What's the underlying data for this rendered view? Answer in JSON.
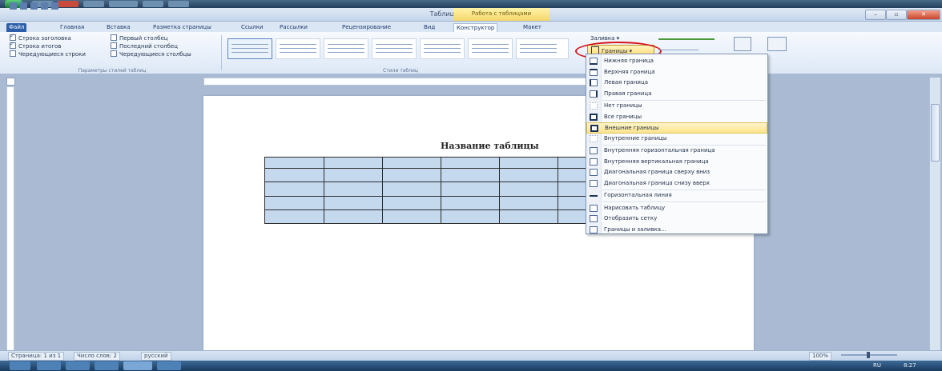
{
  "window": {
    "title": "Таблица - Microsoft Word",
    "context_group": "Работа с таблицами",
    "buttons": {
      "minimize": "–",
      "maximize": "▫",
      "close": "✕"
    }
  },
  "tabs": [
    {
      "label": "Файл",
      "kind": "file"
    },
    {
      "label": "Главная"
    },
    {
      "label": "Вставка"
    },
    {
      "label": "Разметка страницы"
    },
    {
      "label": "Ссылки"
    },
    {
      "label": "Рассылки"
    },
    {
      "label": "Рецензирование"
    },
    {
      "label": "Вид"
    },
    {
      "label": "Конструктор",
      "kind": "active"
    },
    {
      "label": "Макет"
    }
  ],
  "ribbon": {
    "style_options": {
      "col1": [
        {
          "label": "Строка заголовка",
          "checked": true
        },
        {
          "label": "Строка итогов",
          "checked": true
        },
        {
          "label": "Чередующиеся строки",
          "checked": false
        }
      ],
      "col2": [
        {
          "label": "Первый столбец",
          "checked": false
        },
        {
          "label": "Последний столбец",
          "checked": false
        },
        {
          "label": "Чередующиеся столбцы",
          "checked": false
        }
      ],
      "group_label": "Параметры стилей таблиц"
    },
    "styles_group_label": "Стили таблиц",
    "fill_label": "Заливка ▾",
    "borders_label": "Границы ▾",
    "draw_table": "Нарисовать таблицу",
    "eraser": "Ластик"
  },
  "document": {
    "heading": "Название таблицы",
    "table": {
      "rows": 4,
      "cols": 6
    }
  },
  "menu": {
    "items": [
      {
        "label": "Нижняя граница"
      },
      {
        "label": "Верхняя граница"
      },
      {
        "label": "Левая граница"
      },
      {
        "label": "Правая граница"
      },
      {
        "label": "Нет границы"
      },
      {
        "label": "Все границы"
      },
      {
        "label": "Внешние границы",
        "highlighted": true
      },
      {
        "label": "Внутренние границы"
      },
      {
        "label": "Внутренняя горизонтальная граница"
      },
      {
        "label": "Внутренняя вертикальная граница"
      },
      {
        "label": "Диагональная граница сверху вниз"
      },
      {
        "label": "Диагональная граница снизу вверх"
      },
      {
        "label": "Горизонтальная линия"
      },
      {
        "label": "Нарисовать таблицу"
      },
      {
        "label": "Отобразить сетку"
      },
      {
        "label": "Границы и заливка..."
      }
    ]
  },
  "status": {
    "page": "Страница: 1 из 1",
    "words": "Число слов: 2",
    "language": "русский",
    "zoom_label": "100%"
  },
  "taskbar": {
    "lang": "RU",
    "time": "8:27"
  }
}
